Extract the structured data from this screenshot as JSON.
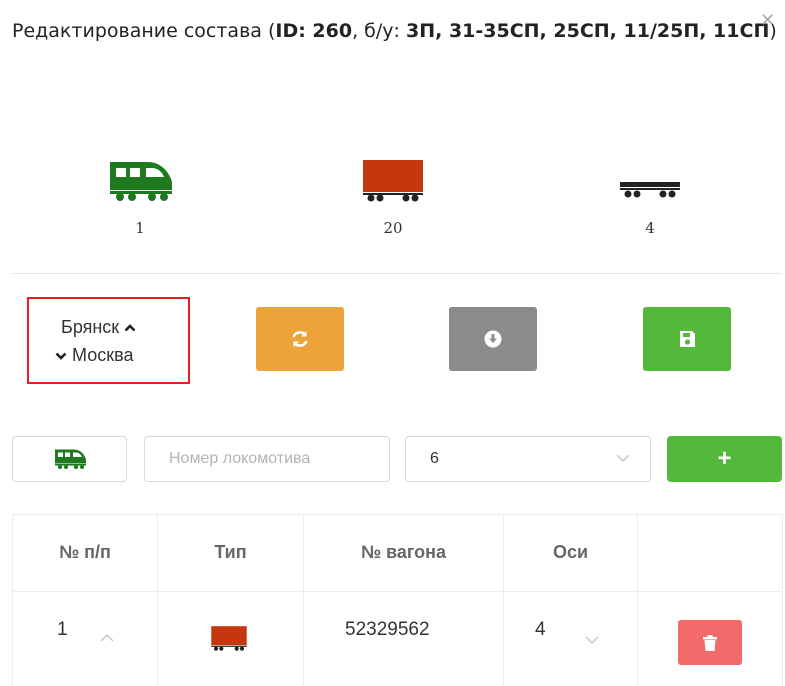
{
  "header": {
    "title_prefix": "Редактирование состава (",
    "id_label": "ID: 260",
    "sep": ", б/у: ",
    "bu_values": "3П, 31-35СП, 25СП, 11/25П, 11СП",
    "title_suffix": ")",
    "close_label": "✕"
  },
  "summary": [
    {
      "icon": "locomotive-icon",
      "count": "1",
      "color": "#1e7a1e"
    },
    {
      "icon": "freight-wagon-icon",
      "count": "20",
      "color": "#c5380f"
    },
    {
      "icon": "platform-wagon-icon",
      "count": "4",
      "color": "#222222"
    }
  ],
  "route": {
    "from": "Брянск",
    "to": "Москва"
  },
  "actions": {
    "refresh_icon": "refresh-icon",
    "download_icon": "download-icon",
    "save_icon": "save-icon",
    "colors": {
      "orange": "#eba33a",
      "gray": "#8a8b8d",
      "green": "#53b93a",
      "red": "#f36a6a"
    }
  },
  "form": {
    "loco_icon": "locomotive-icon",
    "number_placeholder": "Номер локомотива",
    "number_value": "",
    "axes_value": "6",
    "add_label": "+"
  },
  "table": {
    "headers": [
      "№ п/п",
      "Тип",
      "№ вагона",
      "Оси"
    ],
    "rows": [
      {
        "index": "1",
        "type_icon": "freight-wagon-icon",
        "wagon_number": "52329562",
        "axes": "4"
      }
    ]
  }
}
